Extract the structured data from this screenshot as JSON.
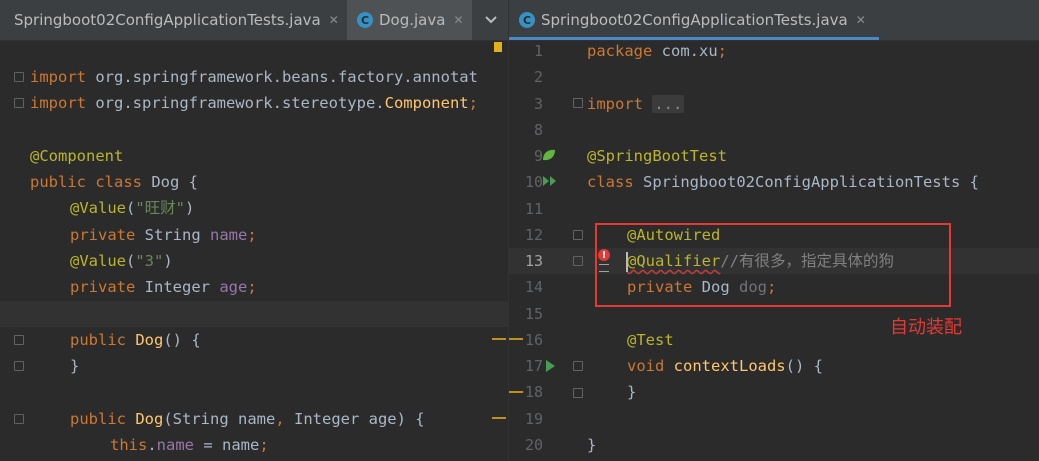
{
  "left_tabs": [
    {
      "label": "Springboot02ConfigApplicationTests.java",
      "close": "✕"
    },
    {
      "label": "Dog.java",
      "icon": "C",
      "close": "✕"
    }
  ],
  "right_tabs": [
    {
      "label": "Springboot02ConfigApplicationTests.java",
      "icon": "C",
      "close": "✕"
    }
  ],
  "chevron": "⌄",
  "left_code": {
    "line1": {
      "kw": "import",
      "rest": " org.springframework.beans.factory.annotat"
    },
    "line2": {
      "kw": "import",
      "rest": " org.springframework.stereotype.",
      "hl": "Component",
      "end": ";"
    },
    "line4": {
      "an": "@Component"
    },
    "line5": {
      "kw": "public class",
      "rest": " Dog {"
    },
    "line6": {
      "an": "@Value",
      "p1": "(",
      "st": "\"旺财\"",
      "p2": ")"
    },
    "line7": {
      "kw": "private",
      "rest": " String ",
      "fd": "name",
      "end": ";"
    },
    "line8": {
      "an": "@Value",
      "p1": "(",
      "st": "\"3\"",
      "p2": ")"
    },
    "line9": {
      "kw": "private",
      "rest": " Integer ",
      "fd": "age",
      "end": ";"
    },
    "line11": {
      "kw": "public",
      "fn": " Dog",
      "rest": "() {"
    },
    "line12": {
      "rest": "}"
    },
    "line14": {
      "kw": "public",
      "fn": " Dog",
      "rest": "(String name",
      "comma": ",",
      "rest2": " Integer age) {"
    },
    "line15": {
      "kw": "this",
      "dot": ".",
      "fd": "name",
      "rest": " = name",
      "end": ";"
    }
  },
  "right_code": [
    {
      "num": "1"
    },
    {
      "num": "2"
    },
    {
      "num": "3"
    },
    {
      "num": "8"
    },
    {
      "num": "9"
    },
    {
      "num": "10"
    },
    {
      "num": "11"
    },
    {
      "num": "12"
    },
    {
      "num": "13"
    },
    {
      "num": "14"
    },
    {
      "num": "15"
    },
    {
      "num": "16"
    },
    {
      "num": "17"
    },
    {
      "num": "18"
    },
    {
      "num": "19"
    },
    {
      "num": "20"
    }
  ],
  "right_text": {
    "pkg_kw": "package",
    "pkg_rest": " com.xu",
    "pkg_end": ";",
    "imp_kw": "import",
    "imp_fold": "...",
    "sbt": "@SpringBootTest",
    "cls_kw": "class",
    "cls_rest": " Springboot02ConfigApplicationTests {",
    "autowired": "@Autowired",
    "qualifier": "@Qualifier",
    "qual_comment": "//有很多，指定具体的狗",
    "field_kw": "private",
    "field_type": " Dog ",
    "field_name": "dog",
    "field_end": ";",
    "test": "@Test",
    "void_kw": "void",
    "method": " contextLoads",
    "method_rest": "() {",
    "close_inner": "}",
    "close_outer": "}"
  },
  "annotation_label": "自动装配",
  "error_icon": "!",
  "colors": {
    "keyword": "#cc7832",
    "annotation": "#bbb529",
    "string": "#6a8759",
    "field": "#9876aa",
    "method": "#ffc66d",
    "highlight": "#e53935"
  }
}
